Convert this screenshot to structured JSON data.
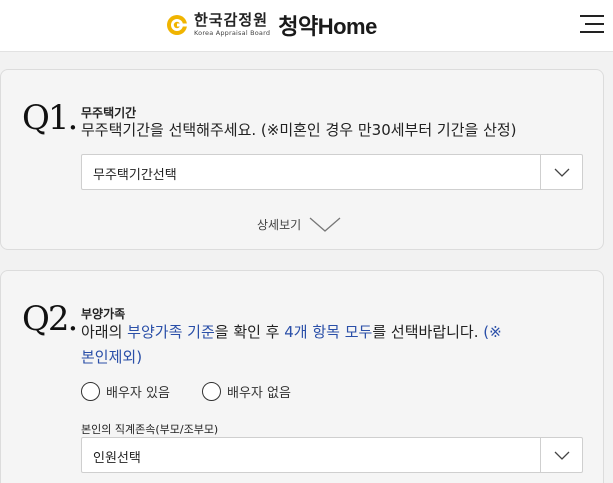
{
  "header": {
    "org_name": "한국감정원",
    "org_english": "Korea Appraisal Board",
    "brand_korean": "청약",
    "brand_english": "Home",
    "icons": {
      "logo": "kab-logo-icon",
      "menu": "hamburger-menu-icon"
    }
  },
  "q1": {
    "number": "Q1.",
    "label": "무주택기간",
    "question": "무주택기간을 선택해주세요. (※미혼인 경우 만30세부터 기간을 산정)",
    "select_value": "무주택기간선택",
    "more_label": "상세보기"
  },
  "q2": {
    "number": "Q2.",
    "label": "부양가족",
    "question_parts": [
      "아래의 ",
      "부양가족 기준",
      "을 확인 후 ",
      "4개 항목 모두",
      "를 선택바랍니다. ",
      "(※",
      "본인제외)"
    ],
    "radio_options": [
      "배우자 있음",
      "배우자 없음"
    ],
    "sub_label": "본인의 직계존속(부모/조부모)",
    "select_value": "인원선택"
  },
  "colors": {
    "accent_blue": "#2a4fa8",
    "logo_gold": "#f0b400"
  }
}
